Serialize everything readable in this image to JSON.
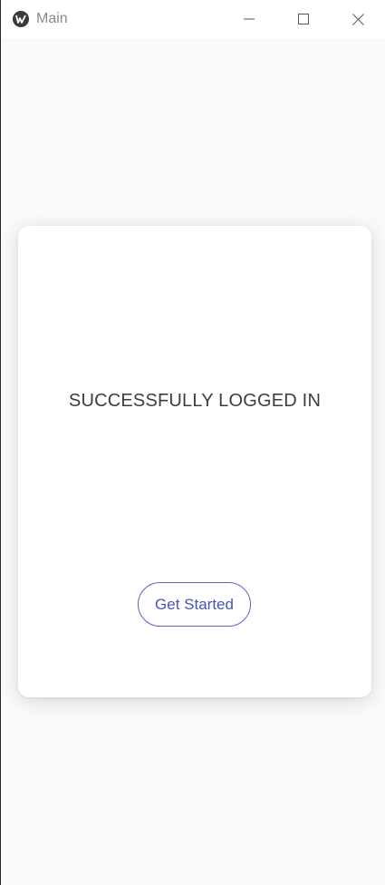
{
  "window": {
    "title": "Main",
    "icon": "kivy-app-icon",
    "controls": {
      "minimize": "minimize-icon",
      "maximize": "maximize-icon",
      "close": "close-icon"
    }
  },
  "card": {
    "status_text": "SUCCESSFULLY LOGGED IN",
    "button_label": "Get Started"
  },
  "colors": {
    "background": "#fafafa",
    "card": "#ffffff",
    "text": "#3d3d3d",
    "accent": "#4756b5"
  }
}
